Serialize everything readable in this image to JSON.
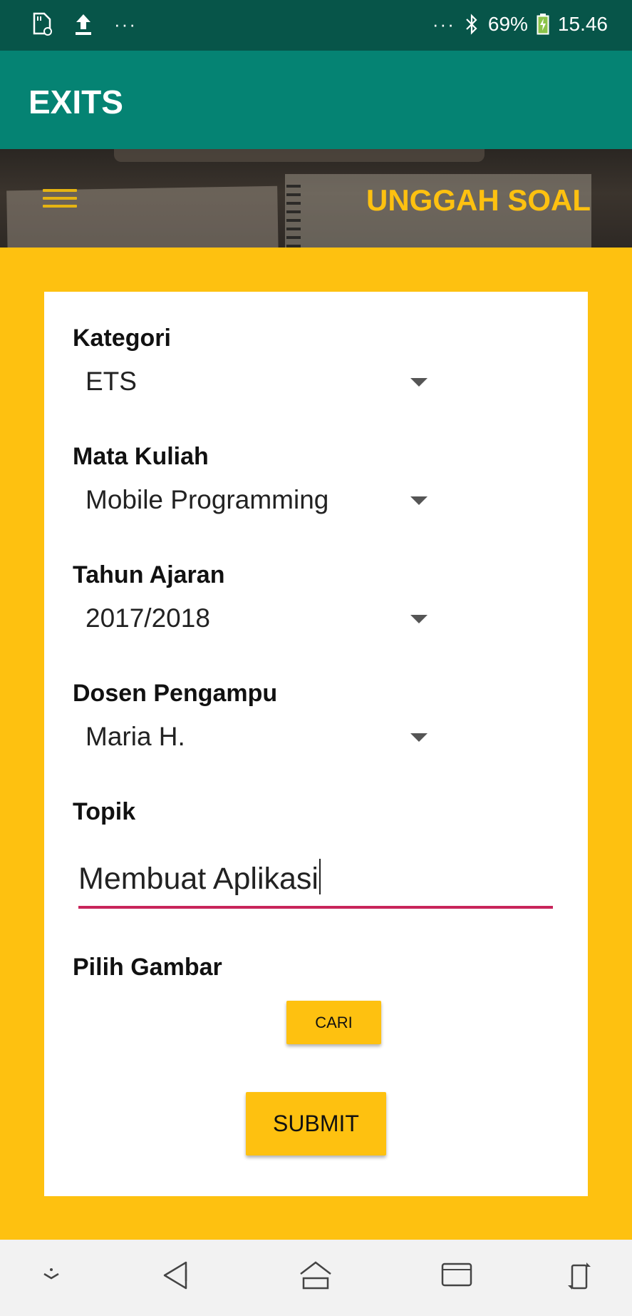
{
  "status_bar": {
    "left_icons": [
      "sd-card-icon",
      "upload-icon",
      "more-icon"
    ],
    "more_dots": "···",
    "right_more_dots": "···",
    "battery": "69%",
    "time": "15.46"
  },
  "app_bar": {
    "title": "EXITS"
  },
  "banner": {
    "title": "UNGGAH SOAL"
  },
  "form": {
    "kategori_label": "Kategori",
    "kategori_value": "ETS",
    "mata_kuliah_label": "Mata Kuliah",
    "mata_kuliah_value": "Mobile Programming",
    "tahun_ajaran_label": "Tahun Ajaran",
    "tahun_ajaran_value": "2017/2018",
    "dosen_label": "Dosen Pengampu",
    "dosen_value": "Maria H.",
    "topik_label": "Topik",
    "topik_value": "Membuat Aplikasi",
    "pilih_gambar_label": "Pilih Gambar",
    "cari_button": "CARI",
    "submit_button": "SUBMIT"
  },
  "colors": {
    "status_bar": "#075549",
    "app_bar": "#058373",
    "accent": "#fec110",
    "input_underline": "#c8245a"
  },
  "nav_bar": {
    "icons": [
      "notification-pull-icon",
      "back-icon",
      "home-icon",
      "recents-icon",
      "rotate-icon"
    ]
  }
}
